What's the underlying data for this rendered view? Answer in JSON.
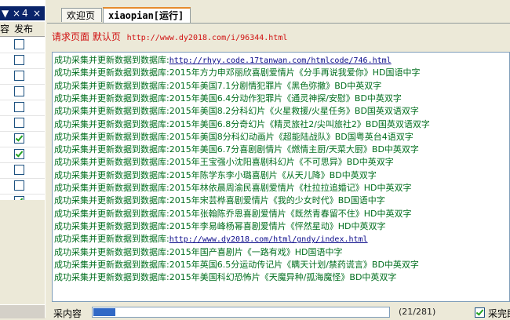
{
  "left_panel": {
    "header_glyphs": [
      "▼",
      "×",
      "4",
      "×"
    ],
    "tabs": [
      "容",
      "发布"
    ],
    "checkboxes": [
      false,
      false,
      false,
      false,
      false,
      false,
      true,
      true,
      false,
      false,
      true,
      false
    ]
  },
  "tabs": [
    {
      "label": "欢迎页"
    },
    {
      "label": "xiaopian[运行]"
    }
  ],
  "url_bar": {
    "label": "请求页面 默认页",
    "url": "http://www.dy2018.com/i/96344.html"
  },
  "log": {
    "prefix": "成功采集并更新数据到数据库:",
    "lines": [
      {
        "text": "http://rhyy.code.17tanwan.com/htmlcode/746.html",
        "link": true
      },
      {
        "text": "2015年方力申邓丽欣喜剧爱情片《分手再说我爱你》HD国语中字",
        "link": false
      },
      {
        "text": "2015年美国7.1分剧情犯罪片《黑色弥撒》BD中英双字",
        "link": false
      },
      {
        "text": "2015年美国6.4分动作犯罪片《通灵神探/安慰》BD中英双字",
        "link": false
      },
      {
        "text": "2015年美国8.2分科幻片《火星救援/火星任务》BD国英双语双字",
        "link": false
      },
      {
        "text": "2015年美国6.8分奇幻片《精灵旅社2/尖叫旅社2》BD国英双语双字",
        "link": false
      },
      {
        "text": "2015年美国8分科幻动画片《超能陆战队》BD国粤英台4语双字",
        "link": false
      },
      {
        "text": "2015年美国6.7分喜剧剧情片《燃情主厨/天菜大厨》BD中英双字",
        "link": false
      },
      {
        "text": "2015年王宝强小沈阳喜剧科幻片《不可思异》BD中英双字",
        "link": false
      },
      {
        "text": "2015年陈学东李小璐喜剧片《从天儿降》BD中英双字",
        "link": false
      },
      {
        "text": "2015年林依晨周渝民喜剧爱情片《杜拉拉追婚记》HD中英双字",
        "link": false
      },
      {
        "text": "2015年宋芸桦喜剧爱情片《我的少女时代》BD国语中字",
        "link": false
      },
      {
        "text": "2015年张翰陈乔恩喜剧爱情片《既然青春留不住》HD中英双字",
        "link": false
      },
      {
        "text": "2015年李易峰杨幂喜剧爱情片《怦然星动》HD中英双字",
        "link": false
      },
      {
        "text": "http://www.dy2018.com/html/gndy/index.html",
        "link": true
      },
      {
        "text": "2015年国产喜剧片《一路有戏》HD国语中字",
        "link": false
      },
      {
        "text": "2015年英国6.5分运动传记片《瞒天计划/禁药谎言》BD中英双字",
        "link": false
      },
      {
        "text": "2015年美国科幻恐怖片《天魔异种/孤海魔怪》BD中英双字",
        "link": false
      }
    ]
  },
  "status": {
    "label": "采内容",
    "progress": 0.075,
    "progress_text": "(21/281)",
    "stop_label": "采完即停",
    "stop_checked": true
  },
  "colors": {
    "log_text": "#006e1e",
    "link": "#0a0a8a",
    "url_bar": "#d01010",
    "progress": "#3169c6"
  }
}
